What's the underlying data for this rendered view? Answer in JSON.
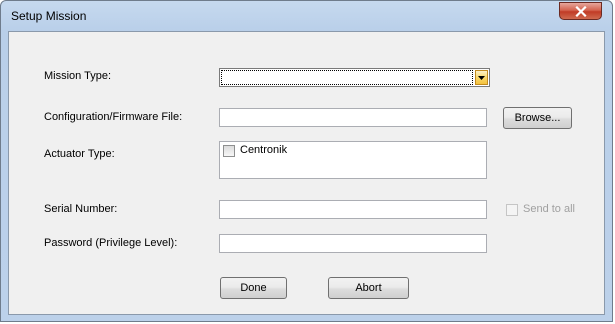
{
  "window": {
    "title": "Setup Mission",
    "close_icon": "close-x-icon"
  },
  "form": {
    "mission_type": {
      "label": "Mission Type:",
      "value": ""
    },
    "config_file": {
      "label": "Configuration/Firmware File:",
      "value": "",
      "browse_label": "Browse..."
    },
    "actuator_type": {
      "label": "Actuator Type:",
      "options": [
        {
          "label": "Centronik",
          "checked": false
        }
      ]
    },
    "serial_number": {
      "label": "Serial Number:",
      "value": "",
      "send_to_all_label": "Send to all",
      "send_to_all_checked": false,
      "send_to_all_enabled": false
    },
    "password": {
      "label": "Password (Privilege Level):",
      "value": ""
    }
  },
  "buttons": {
    "done_label": "Done",
    "abort_label": "Abort"
  },
  "colors": {
    "title_bar": "#bcd1ea",
    "client_bg": "#f0f0f0",
    "close_button": "#c13c26",
    "dropdown_button": "#f4c23e"
  }
}
